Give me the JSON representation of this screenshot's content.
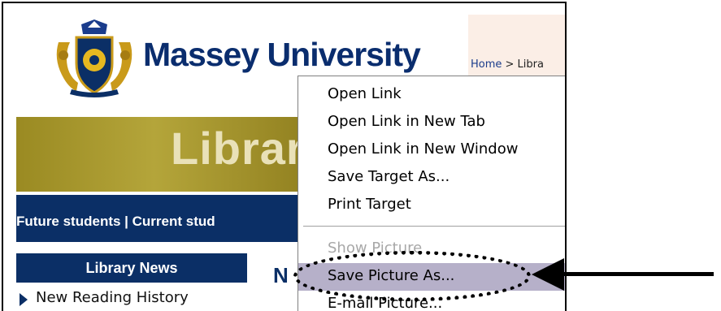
{
  "header": {
    "brand": "Massey University",
    "breadcrumb_home": "Home",
    "breadcrumb_rest": " > Libra"
  },
  "banner": {
    "title": "Librar"
  },
  "navbar": {
    "text": "Future students | Current stud"
  },
  "sidebar": {
    "heading": "Library News",
    "items": [
      {
        "label": "New Reading History"
      }
    ]
  },
  "main": {
    "heading_fragment": "N"
  },
  "context_menu": {
    "items": [
      {
        "label": "Open Link",
        "enabled": true
      },
      {
        "label": "Open Link in New Tab",
        "enabled": true
      },
      {
        "label": "Open Link in New Window",
        "enabled": true
      },
      {
        "label": "Save Target As...",
        "enabled": true
      },
      {
        "label": "Print Target",
        "enabled": true
      },
      {
        "label": "Show Picture",
        "enabled": false
      },
      {
        "label": "Save Picture As...",
        "enabled": true,
        "highlighted": true
      },
      {
        "label": "E-mail Picture...",
        "enabled": true
      }
    ]
  },
  "colors": {
    "brand_navy": "#0b2f66",
    "banner_olive": "#9a8a22",
    "menu_highlight": "#b6b0c9"
  },
  "icons": {
    "crest": "university-crest-icon",
    "bullet": "triangle-right-icon"
  }
}
